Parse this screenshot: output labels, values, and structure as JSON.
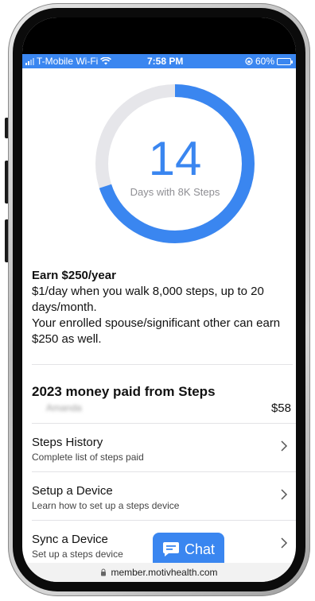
{
  "status_bar": {
    "carrier": "T-Mobile Wi-Fi",
    "time": "7:58 PM",
    "battery": "60%",
    "battery_level": 0.6
  },
  "progress_ring": {
    "value": "14",
    "caption": "Days with 8K Steps",
    "fraction": 0.7
  },
  "earn": {
    "title": "Earn $250/year",
    "line1": "$1/day when you walk 8,000 steps, up to 20 days/month.",
    "line2": "Your enrolled spouse/significant other can earn $250 as well."
  },
  "money": {
    "title": "2023 money paid from Steps",
    "member_name": "Amanda",
    "amount": "$58"
  },
  "list": [
    {
      "title": "Steps History",
      "subtitle": "Complete list of steps paid"
    },
    {
      "title": "Setup a Device",
      "subtitle": "Learn how to set up a steps device"
    },
    {
      "title": "Sync a Device",
      "subtitle": "Set up a steps device"
    }
  ],
  "chat": {
    "label": "Chat"
  },
  "browser": {
    "url": "member.motivhealth.com"
  },
  "colors": {
    "accent": "#3a86f0",
    "ring_track": "#e6e6ea"
  }
}
